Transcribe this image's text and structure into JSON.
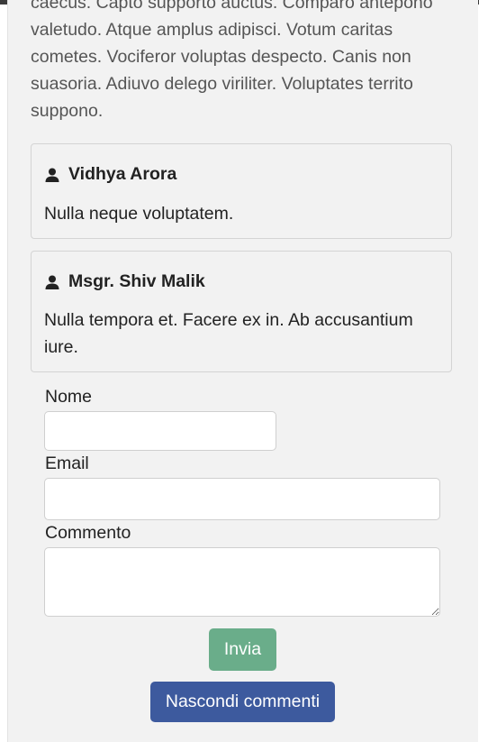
{
  "post": {
    "text": "caecus. Capto supporto auctus. Comparo antepono valetudo. Atque amplus adipisci. Votum caritas cometes. Vociferor voluptas despecto. Canis non suasoria. Adiuvo delego viriliter. Voluptates territo suppono."
  },
  "comments": [
    {
      "author": "Vidhya Arora",
      "body": "Nulla neque voluptatem.",
      "icon": "user-icon"
    },
    {
      "author": "Msgr. Shiv Malik",
      "body": "Nulla tempora et. Facere ex in. Ab accusantium iure.",
      "icon": "user-icon"
    }
  ],
  "form": {
    "name_label": "Nome",
    "name_value": "",
    "email_label": "Email",
    "email_value": "",
    "comment_label": "Commento",
    "comment_value": "",
    "submit_label": "Invia",
    "hide_comments_label": "Nascondi commenti"
  },
  "colors": {
    "submit_button": "#6aad8a",
    "hide_button": "#3d5a9e",
    "panel_background": "#f2f2f2"
  }
}
